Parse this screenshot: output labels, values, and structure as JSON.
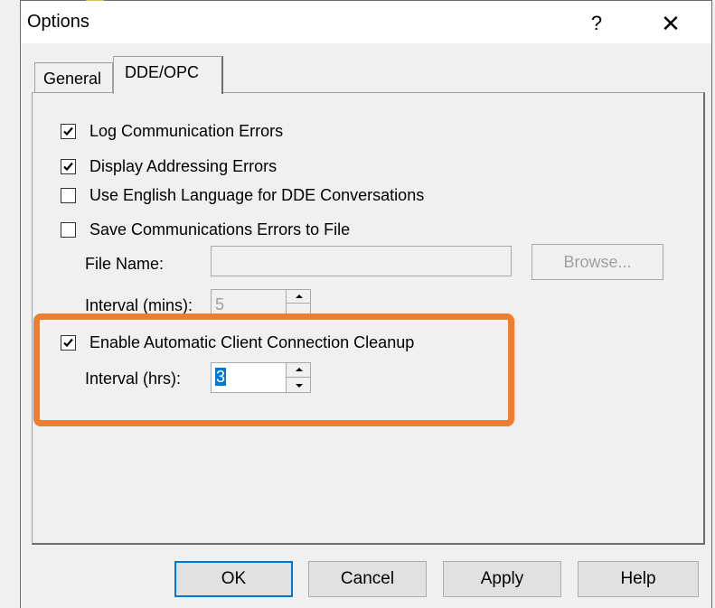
{
  "window": {
    "title": "Options",
    "help_glyph": "?",
    "close_glyph": "✕"
  },
  "tabs": [
    {
      "label": "General",
      "active": false
    },
    {
      "label": "DDE/OPC",
      "active": true
    }
  ],
  "checkboxes": [
    {
      "label": "Log Communication Errors",
      "checked": true
    },
    {
      "label": "Display Addressing Errors",
      "checked": true
    },
    {
      "label": "Use English Language for DDE Conversations",
      "checked": false
    },
    {
      "label": "Save Communications Errors to File",
      "checked": false
    },
    {
      "label": "Enable Automatic Client Connection Cleanup",
      "checked": true
    }
  ],
  "file_name": {
    "label": "File Name:",
    "value": "",
    "browse_label": "Browse..."
  },
  "interval_mins": {
    "label": "Interval (mins):",
    "value": "5"
  },
  "interval_hrs": {
    "label": "Interval (hrs):",
    "value": "3"
  },
  "footer": {
    "ok": "OK",
    "cancel": "Cancel",
    "apply": "Apply",
    "help": "Help"
  },
  "colors": {
    "highlight": "#ed7d31",
    "selection": "#0078d7",
    "dialog_bg": "#f0f0f0"
  }
}
